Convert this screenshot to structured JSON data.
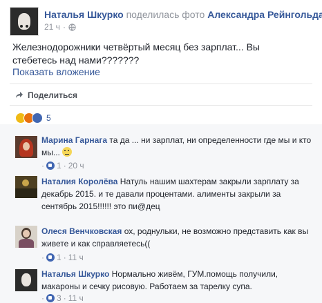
{
  "post": {
    "author": "Наталья Шкурко",
    "action": "поделилась фото",
    "target": "Александра Рейнгольда.",
    "time": "21 ч",
    "text": "Железнодорожники четвёртый месяц без зарплат... Вы стебетесь над нами???????",
    "attachment_link": "Показать вложение",
    "share_label": "Поделиться",
    "reaction_count": "5",
    "colors": {
      "link": "#365899",
      "like": "#4267b2",
      "muted": "#90949c"
    }
  },
  "comments": [
    {
      "author": "Марина Гарнага",
      "text": "та да ... ни зарплат, ни определенности где мы и кто мы...",
      "likes": "1",
      "time": "20 ч",
      "emoji": true
    },
    {
      "author": "Наталия Королёва",
      "text": "Натуль нашим шахтерам закрыли зарплату за декабрь 2015. и те давали процентами. алименты закрыли за сентябрь 2015!!!!!! это пи@дец",
      "likes": "",
      "time": "",
      "emoji": false
    },
    {
      "author": "Олеся Венчковская",
      "text": "ох, роднульки, не возможно представить как вы живете и как справляетесь((",
      "likes": "1",
      "time": "11 ч",
      "emoji": false
    },
    {
      "author": "Наталья Шкурко",
      "text": "Нормально живём, ГУМ.помощь получили, макароны и сечку рисовую. Работаем за тарелку супа.",
      "likes": "3",
      "time": "11 ч",
      "emoji": false
    }
  ]
}
